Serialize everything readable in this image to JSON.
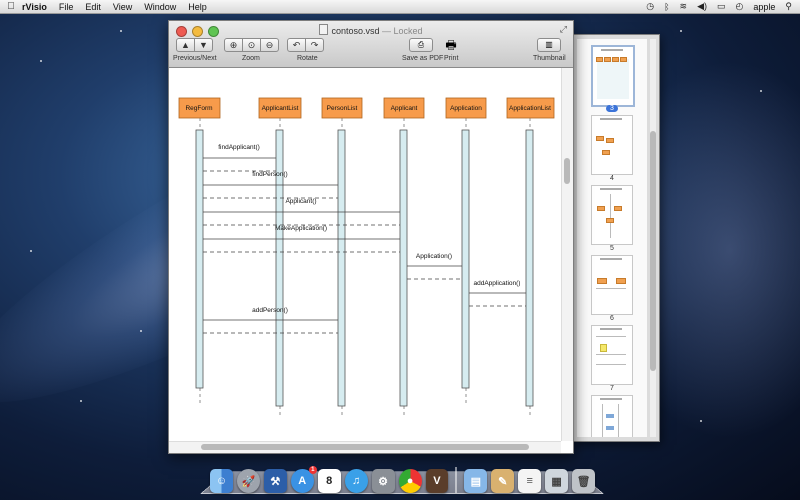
{
  "menubar": {
    "app_name": "rVisio",
    "items": [
      "File",
      "Edit",
      "View",
      "Window",
      "Help"
    ],
    "user": "apple"
  },
  "window": {
    "filename": "contoso.vsd",
    "status": "Locked",
    "separator": "—",
    "toolbar": {
      "prev_next_label": "Previous/Next",
      "zoom_label": "Zoom",
      "rotate_label": "Rotate",
      "save_pdf_label": "Save as PDF",
      "print_label": "Print",
      "thumbnail_label": "Thumbnail"
    }
  },
  "diagram": {
    "lifelines": [
      "RegForm",
      "ApplicantList",
      "PersonList",
      "Applicant",
      "Application",
      "ApplicationList"
    ],
    "messages": [
      "findApplicant()",
      "findPerson()",
      "Applicant()",
      "MakeApplication()",
      "Application()",
      "addApplication()",
      "addPerson()"
    ],
    "colors": {
      "lifeline_box": "#f79b4b",
      "activation": "#d6ecf0"
    }
  },
  "thumbnails": {
    "pages": [
      "3",
      "4",
      "5",
      "6",
      "7"
    ],
    "selected": "3"
  },
  "dock": {
    "icons": [
      "finder-icon",
      "launchpad-icon",
      "xcode-icon",
      "app-store-icon",
      "calendar-icon",
      "itunes-icon",
      "system-preferences-icon",
      "chrome-icon",
      "rvisio-icon",
      "documents-folder-icon",
      "preview-icon",
      "text-document-icon",
      "finder-window-icon",
      "trash-icon"
    ],
    "calendar_day": "8",
    "app_store_badge": "1"
  }
}
